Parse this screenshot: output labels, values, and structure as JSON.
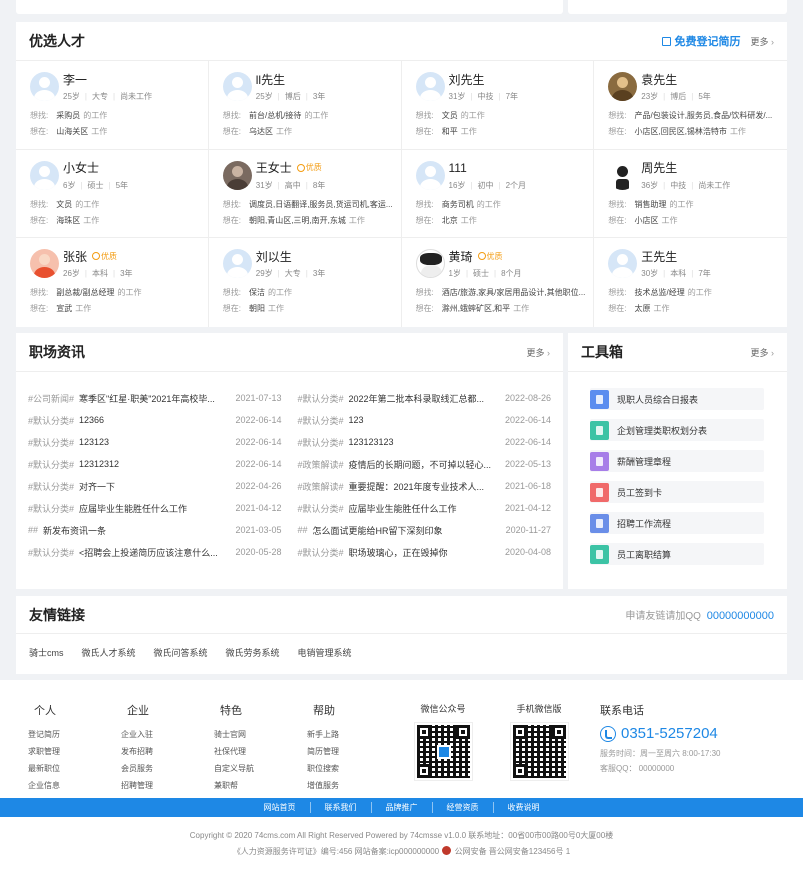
{
  "talents": {
    "title": "优选人才",
    "register_label": "免费登记简历",
    "more": "更多",
    "want_label": "想找:",
    "place_label": "想在:",
    "people": [
      {
        "name": "李一",
        "badge": "",
        "meta": [
          "25岁",
          "大专",
          "尚未工作"
        ],
        "want": "采购员",
        "want_suffix": "的工作",
        "place": "山海关区",
        "place_suffix": "工作",
        "avatar": "default"
      },
      {
        "name": "ll先生",
        "badge": "",
        "meta": [
          "25岁",
          "博后",
          "3年"
        ],
        "want": "前台/总机/接待",
        "want_suffix": "的工作",
        "place": "乌达区",
        "place_suffix": "工作",
        "avatar": "default"
      },
      {
        "name": "刘先生",
        "badge": "",
        "meta": [
          "31岁",
          "中技",
          "7年"
        ],
        "want": "文员",
        "want_suffix": "的工作",
        "place": "和平",
        "place_suffix": "工作",
        "avatar": "default"
      },
      {
        "name": "袁先生",
        "badge": "",
        "meta": [
          "23岁",
          "博后",
          "5年"
        ],
        "want": "产品/包装设计,服务员,食品/饮料研发/...",
        "want_suffix": "",
        "place": "小店区,回民区,锡林浩特市",
        "place_suffix": "工作",
        "avatar": "photo-a"
      },
      {
        "name": "小女士",
        "badge": "",
        "meta": [
          "6岁",
          "硕士",
          "5年"
        ],
        "want": "文员",
        "want_suffix": "的工作",
        "place": "海珠区",
        "place_suffix": "工作",
        "avatar": "default"
      },
      {
        "name": "王女士",
        "badge": "优质",
        "meta": [
          "31岁",
          "高中",
          "8年"
        ],
        "want": "调度员,日语翻译,服务员,货运司机,客运...",
        "want_suffix": "",
        "place": "朝阳,青山区,三明,南开,东城",
        "place_suffix": "工作",
        "avatar": "photo-b"
      },
      {
        "name": "111",
        "badge": "",
        "meta": [
          "16岁",
          "初中",
          "2个月"
        ],
        "want": "商务司机",
        "want_suffix": "的工作",
        "place": "北京",
        "place_suffix": "工作",
        "avatar": "default"
      },
      {
        "name": "周先生",
        "badge": "",
        "meta": [
          "36岁",
          "中技",
          "尚未工作"
        ],
        "want": "销售助理",
        "want_suffix": "的工作",
        "place": "小店区",
        "place_suffix": "工作",
        "avatar": "photo-c"
      },
      {
        "name": "张张",
        "badge": "优质",
        "meta": [
          "26岁",
          "本科",
          "3年"
        ],
        "want": "副总裁/副总经理",
        "want_suffix": "的工作",
        "place": "宣武",
        "place_suffix": "工作",
        "avatar": "photo-d"
      },
      {
        "name": "刘以生",
        "badge": "",
        "meta": [
          "29岁",
          "大专",
          "3年"
        ],
        "want": "保洁",
        "want_suffix": "的工作",
        "place": "朝阳",
        "place_suffix": "工作",
        "avatar": "default"
      },
      {
        "name": "黄琦",
        "badge": "优质",
        "meta": [
          "1岁",
          "硕士",
          "8个月"
        ],
        "want": "酒店/旅游,家具/家居用品设计,其他职位...",
        "want_suffix": "",
        "place": "滁州,蛾蟀矿区,和平",
        "place_suffix": "工作",
        "avatar": "photo-e"
      },
      {
        "name": "王先生",
        "badge": "",
        "meta": [
          "30岁",
          "本科",
          "7年"
        ],
        "want": "技术总监/经理",
        "want_suffix": "的工作",
        "place": "太原",
        "place_suffix": "工作",
        "avatar": "default"
      }
    ]
  },
  "news": {
    "title": "职场资讯",
    "more": "更多",
    "items": [
      {
        "cat": "#公司新闻#",
        "title": "寒季区\"红星·职美\"2021年高校毕...",
        "date": "2021-07-13"
      },
      {
        "cat": "#默认分类#",
        "title": "2022年第二批本科录取线汇总都...",
        "date": "2022-08-26"
      },
      {
        "cat": "#默认分类#",
        "title": "12366",
        "date": "2022-06-14"
      },
      {
        "cat": "#默认分类#",
        "title": "123",
        "date": "2022-06-14"
      },
      {
        "cat": "#默认分类#",
        "title": "123123",
        "date": "2022-06-14"
      },
      {
        "cat": "#默认分类#",
        "title": "123123123",
        "date": "2022-06-14"
      },
      {
        "cat": "#默认分类#",
        "title": "12312312",
        "date": "2022-06-14"
      },
      {
        "cat": "#政策解读#",
        "title": "疫情后的长期问题，不可掉以轻心...",
        "date": "2022-05-13"
      },
      {
        "cat": "#默认分类#",
        "title": "对齐一下",
        "date": "2022-04-26"
      },
      {
        "cat": "#政策解读#",
        "title": "重要提醒：2021年度专业技术人...",
        "date": "2021-06-18"
      },
      {
        "cat": "#默认分类#",
        "title": "应届毕业生能胜任什么工作",
        "date": "2021-04-12"
      },
      {
        "cat": "#默认分类#",
        "title": "应届毕业生能胜任什么工作",
        "date": "2021-04-12"
      },
      {
        "cat": "##",
        "title": "新发布资讯一条",
        "date": "2021-03-05"
      },
      {
        "cat": "##",
        "title": "怎么面试更能给HR留下深刻印象",
        "date": "2020-11-27"
      },
      {
        "cat": "#默认分类#",
        "title": "<招聘会上投递简历应该注意什么...",
        "date": "2020-05-28"
      },
      {
        "cat": "#默认分类#",
        "title": "职场玻璃心，正在毁掉你",
        "date": "2020-04-08"
      }
    ]
  },
  "tools": {
    "title": "工具箱",
    "more": "更多",
    "items": [
      {
        "name": "现职人员综合日报表",
        "color": "#5b8def"
      },
      {
        "name": "企划管理类职权划分表",
        "color": "#3cc3a5"
      },
      {
        "name": "薪酬管理章程",
        "color": "#a77ee8"
      },
      {
        "name": "员工签到卡",
        "color": "#f06a6a"
      },
      {
        "name": "招聘工作流程",
        "color": "#6a8ee8"
      },
      {
        "name": "员工离职结算",
        "color": "#3cc3a5"
      }
    ]
  },
  "links": {
    "title": "友情链接",
    "apply_label": "申请友链请加QQ",
    "apply_qq": "00000000000",
    "items": [
      "骑士cms",
      "微氏人才系统",
      "微氏问答系统",
      "微氏劳务系统",
      "电销管理系统"
    ]
  },
  "footer": {
    "columns": [
      {
        "title": "个人",
        "links": [
          "登记简历",
          "求职管理",
          "最新职位",
          "企业信息"
        ]
      },
      {
        "title": "企业",
        "links": [
          "企业入驻",
          "发布招聘",
          "会员服务",
          "招聘管理"
        ]
      },
      {
        "title": "特色",
        "links": [
          "骑士官网",
          "社保代理",
          "自定义导航",
          "兼职帮"
        ]
      },
      {
        "title": "帮助",
        "links": [
          "新手上路",
          "简历管理",
          "职位搜索",
          "增值服务"
        ]
      }
    ],
    "qr_wechat": "微信公众号",
    "qr_mobile": "手机微信版",
    "contact_title": "联系电话",
    "phone": "0351-5257204",
    "service_time": "服务时间：周一至周六 8:00-17:30",
    "service_qq": "客服QQ：  00000000",
    "bar_links": [
      "网站首页",
      "联系我们",
      "品牌推广",
      "经营资质",
      "收费说明"
    ],
    "copyright": "Copyright © 2020 74cms.com All Right Reserved Powered by 74cmsse v1.0.0       联系地址：00省00市00路00号0大厦00楼",
    "license_left": "《人力资源服务许可证》编号:456 网站备案:icp000000000",
    "license_right": "公网安备 晋公网安备123456号 1"
  },
  "colors": {
    "accent": "#1e88e5",
    "badge": "#f39c12"
  }
}
